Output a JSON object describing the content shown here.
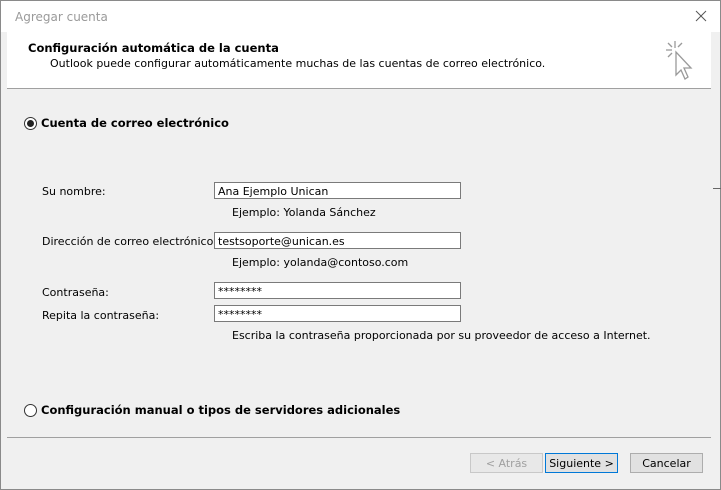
{
  "window": {
    "title": "Agregar cuenta"
  },
  "header": {
    "title": "Configuración automática de la cuenta",
    "subtitle": "Outlook puede configurar automáticamente muchas de las cuentas de correo electrónico."
  },
  "options": {
    "email_account": {
      "label": "Cuenta de correo electrónico",
      "selected": true
    },
    "manual": {
      "label": "Configuración manual o tipos de servidores adicionales",
      "selected": false
    }
  },
  "form": {
    "name": {
      "label": "Su nombre:",
      "value": "Ana Ejemplo Unican",
      "hint": "Ejemplo: Yolanda Sánchez"
    },
    "email": {
      "label": "Dirección de correo electrónico:",
      "value": "testsoporte@unican.es",
      "hint": "Ejemplo: yolanda@contoso.com"
    },
    "password": {
      "label": "Contraseña:",
      "value": "********"
    },
    "password_repeat": {
      "label": "Repita la contraseña:",
      "value": "********",
      "hint": "Escriba la contraseña proporcionada por su proveedor de acceso a Internet."
    }
  },
  "buttons": {
    "back": "< Atrás",
    "next": "Siguiente >",
    "cancel": "Cancelar"
  },
  "icons": {
    "close": "close-icon",
    "wizard": "cursor-click-icon"
  }
}
